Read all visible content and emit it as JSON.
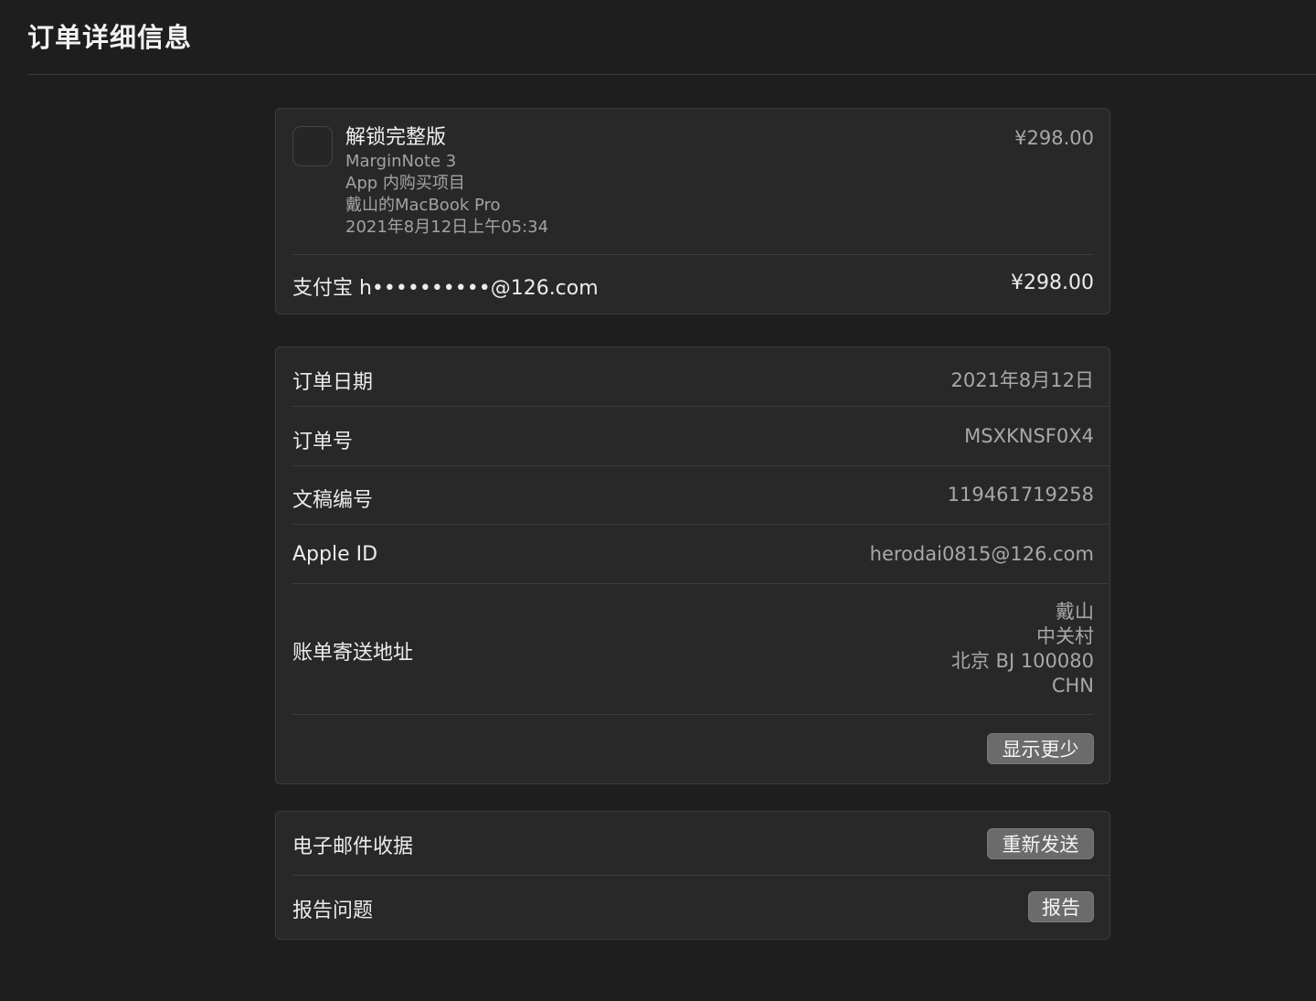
{
  "header": {
    "title": "订单详细信息"
  },
  "product": {
    "name": "解锁完整版",
    "app_name": "MarginNote 3",
    "type": "App 内购买项目",
    "device": "戴山的MacBook Pro",
    "datetime": "2021年8月12日上午05:34",
    "price": "¥298.00",
    "icon": "app-icon-placeholder"
  },
  "payment": {
    "method": "支付宝 h••••••••••@126.com",
    "total": "¥298.00"
  },
  "details": {
    "order_date_label": "订单日期",
    "order_date_value": "2021年8月12日",
    "order_number_label": "订单号",
    "order_number_value": "MSXKNSF0X4",
    "document_number_label": "文稿编号",
    "document_number_value": "119461719258",
    "apple_id_label": "Apple ID",
    "apple_id_value": "herodai0815@126.com",
    "billing_address_label": "账单寄送地址",
    "billing_address_lines": [
      "戴山",
      "中关村",
      "北京 BJ 100080",
      "CHN"
    ],
    "show_less_button": "显示更少"
  },
  "actions": {
    "email_receipt_label": "电子邮件收据",
    "resend_button": "重新发送",
    "report_issue_label": "报告问题",
    "report_button": "报告"
  },
  "colors": {
    "background": "#1e1e1e",
    "card": "#282828",
    "button": "#6b6b6b"
  }
}
